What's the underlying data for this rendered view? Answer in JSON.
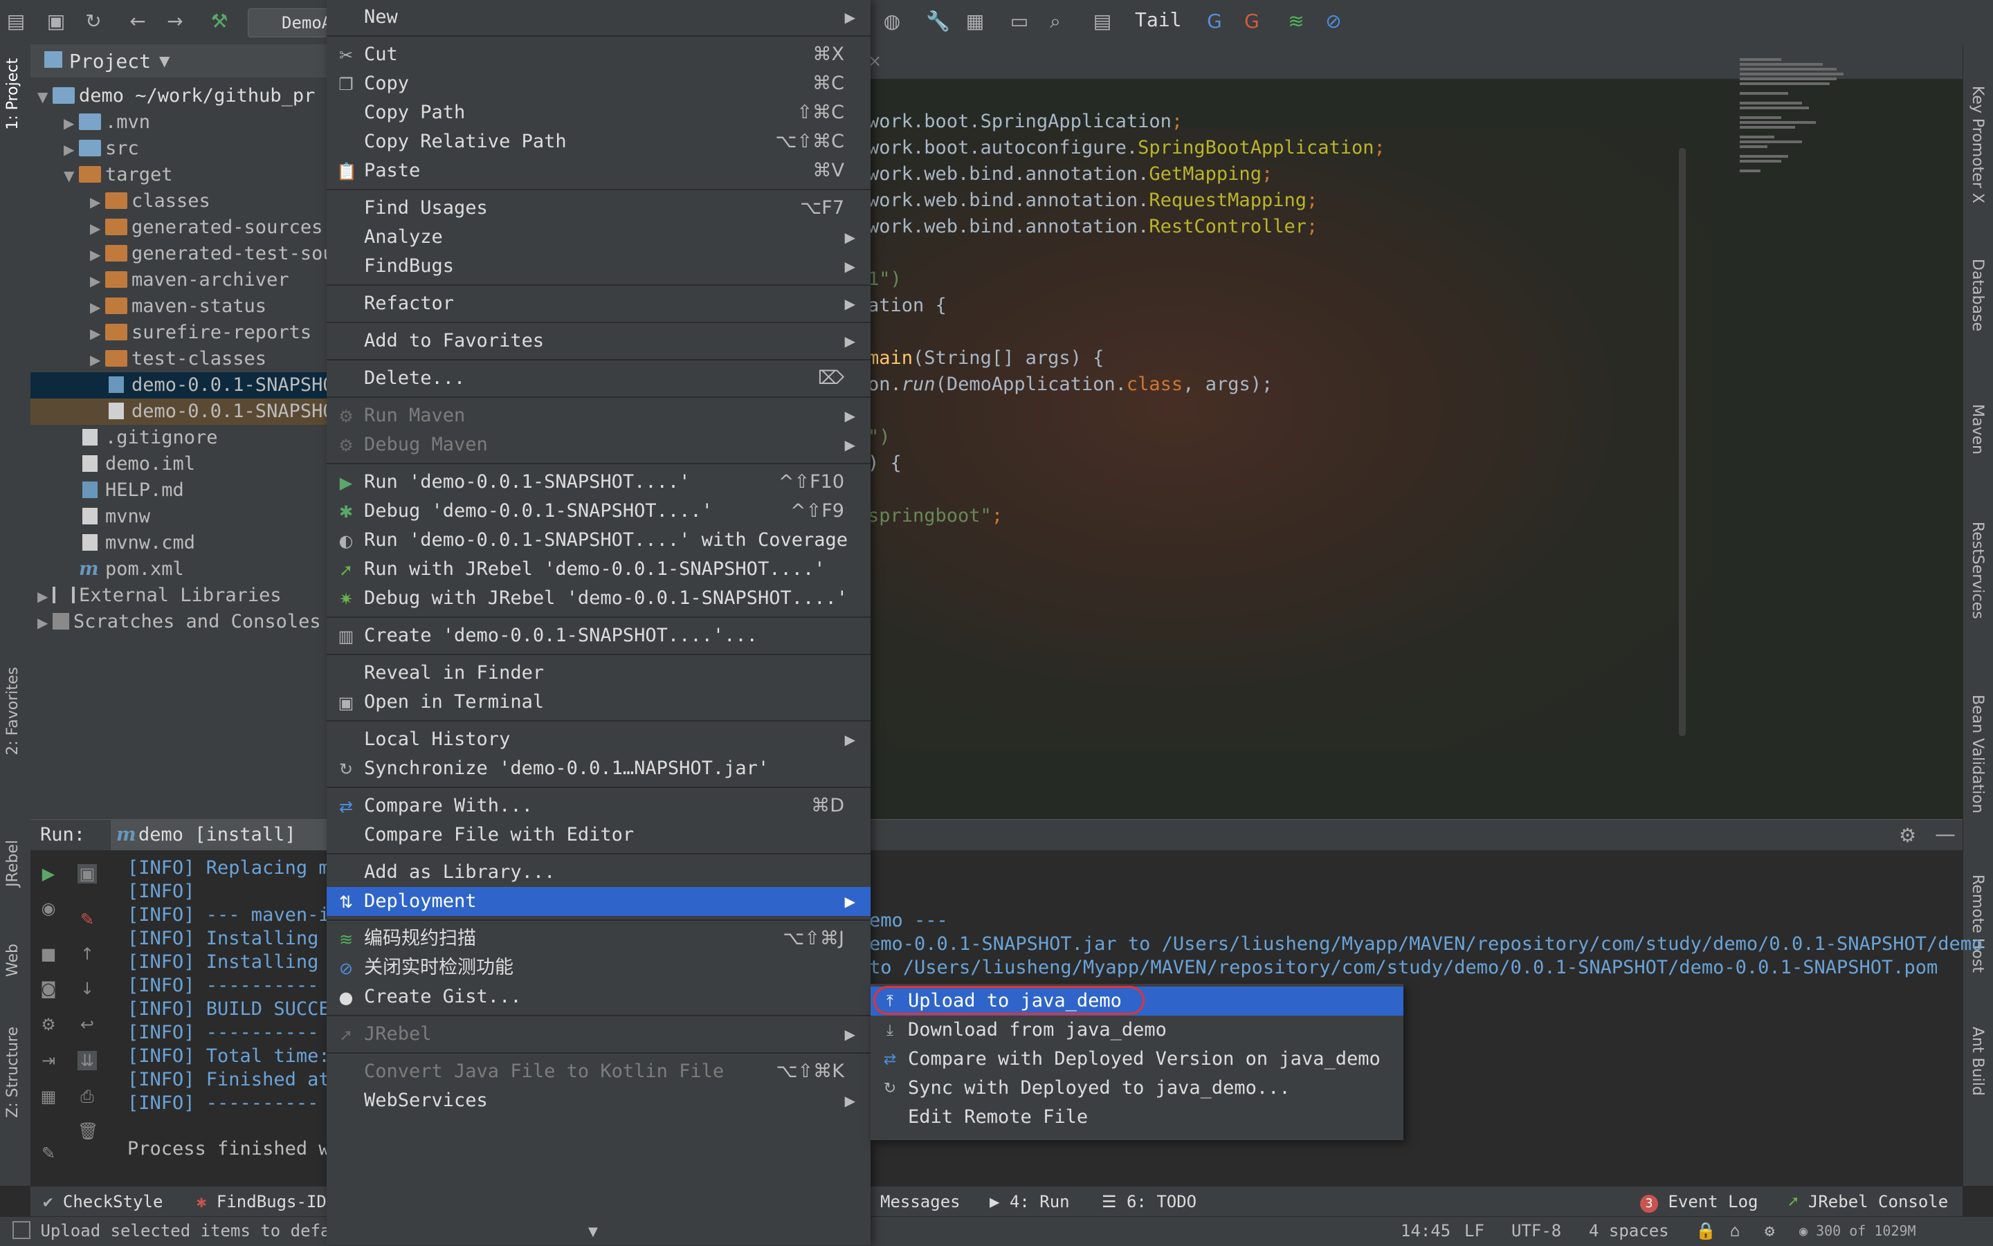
{
  "toolbar": {
    "run_config": "DemoA",
    "tail_label": "Tail",
    "icons": [
      "save-icon",
      "sync-icon",
      "back-icon",
      "forward-icon",
      "build-icon",
      "wrench-icon",
      "project-structure-icon",
      "terminal-icon",
      "search-icon",
      "tasks-icon",
      "translate-icon",
      "translate-alt-icon",
      "scan-icon",
      "no-realtime-icon"
    ]
  },
  "left_strip": {
    "project_tab": "1: Project",
    "favorites_tab": "2: Favorites",
    "jrebel_tab": "JRebel",
    "web_tab": "Web",
    "structure_tab": "Z: Structure"
  },
  "right_strip": {
    "key_promoter": "Key Promoter X",
    "database": "Database",
    "maven": "Maven",
    "rest_services": "RestServices",
    "bean_validation": "Bean Validation",
    "remote_host": "Remote Host",
    "ant_build": "Ant Build"
  },
  "project": {
    "title": "Project",
    "tree": [
      {
        "label": "demo  ~/work/github_pr",
        "level": 0,
        "type": "module"
      },
      {
        "label": ".mvn",
        "level": 1,
        "type": "folder"
      },
      {
        "label": "src",
        "level": 1,
        "type": "folder"
      },
      {
        "label": "target",
        "level": 1,
        "type": "folder-orange"
      },
      {
        "label": "classes",
        "level": 2,
        "type": "folder-orange"
      },
      {
        "label": "generated-sources",
        "level": 2,
        "type": "folder-orange"
      },
      {
        "label": "generated-test-sou",
        "level": 2,
        "type": "folder-orange"
      },
      {
        "label": "maven-archiver",
        "level": 2,
        "type": "folder-orange"
      },
      {
        "label": "maven-status",
        "level": 2,
        "type": "folder-orange"
      },
      {
        "label": "surefire-reports",
        "level": 2,
        "type": "folder-orange"
      },
      {
        "label": "test-classes",
        "level": 2,
        "type": "folder-orange"
      },
      {
        "label": "demo-0.0.1-SNAPSHO",
        "level": 2,
        "type": "jar"
      },
      {
        "label": "demo-0.0.1-SNAPSHO",
        "level": 2,
        "type": "file"
      },
      {
        "label": ".gitignore",
        "level": 1,
        "type": "file"
      },
      {
        "label": "demo.iml",
        "level": 1,
        "type": "file"
      },
      {
        "label": "HELP.md",
        "level": 1,
        "type": "md"
      },
      {
        "label": "mvnw",
        "level": 1,
        "type": "file"
      },
      {
        "label": "mvnw.cmd",
        "level": 1,
        "type": "file"
      },
      {
        "label": "pom.xml",
        "level": 1,
        "type": "maven"
      },
      {
        "label": "External Libraries",
        "level": 0,
        "type": "libs"
      },
      {
        "label": "Scratches and Consoles",
        "level": 0,
        "type": "scratches"
      }
    ]
  },
  "editor": {
    "lines": [
      {
        "segments": [
          {
            "t": "work.boot.",
            "c": "plain"
          },
          {
            "t": "SpringApplication",
            "c": "plain"
          },
          {
            "t": ";",
            "c": "kw"
          }
        ]
      },
      {
        "segments": [
          {
            "t": "work.boot.autoconfigure.",
            "c": "plain"
          },
          {
            "t": "SpringBootApplication",
            "c": "ann"
          },
          {
            "t": ";",
            "c": "kw"
          }
        ]
      },
      {
        "segments": [
          {
            "t": "work.web.bind.annotation.",
            "c": "plain"
          },
          {
            "t": "GetMapping",
            "c": "ann"
          },
          {
            "t": ";",
            "c": "kw"
          }
        ]
      },
      {
        "segments": [
          {
            "t": "work.web.bind.annotation.",
            "c": "plain"
          },
          {
            "t": "RequestMapping",
            "c": "ann"
          },
          {
            "t": ";",
            "c": "kw"
          }
        ]
      },
      {
        "segments": [
          {
            "t": "work.web.bind.annotation.",
            "c": "plain"
          },
          {
            "t": "RestController",
            "c": "ann"
          },
          {
            "t": ";",
            "c": "kw"
          }
        ]
      },
      {
        "segments": [
          {
            "t": "1\")",
            "c": "str"
          }
        ]
      },
      {
        "segments": [
          {
            "t": "ation {",
            "c": "plain"
          }
        ]
      },
      {
        "segments": [
          {
            "t": "main",
            "c": "cls"
          },
          {
            "t": "(String[] args) {",
            "c": "plain"
          }
        ]
      },
      {
        "segments": [
          {
            "t": "on.",
            "c": "plain"
          },
          {
            "t": "run",
            "c": "ital"
          },
          {
            "t": "(DemoApplication.",
            "c": "plain"
          },
          {
            "t": "class",
            "c": "kw"
          },
          {
            "t": ", args);",
            "c": "plain"
          }
        ]
      },
      {
        "segments": [
          {
            "t": "\")",
            "c": "str"
          }
        ]
      },
      {
        "segments": [
          {
            "t": ") {",
            "c": "plain"
          }
        ]
      },
      {
        "segments": [
          {
            "t": "springboot\"",
            "c": "str"
          },
          {
            "t": ";",
            "c": "kw"
          }
        ]
      }
    ]
  },
  "run": {
    "label": "Run:",
    "tab_label": "demo [install]",
    "lines": [
      "[INFO] Replacing m",
      "[INFO]",
      "[INFO] --- maven-i",
      "[INFO] Installing",
      "[INFO] Installing",
      "[INFO] ----------",
      "[INFO] BUILD SUCCE",
      "[INFO] ----------",
      "[INFO] Total time:",
      "[INFO] Finished at",
      "[INFO] ----------"
    ],
    "right_lines": [
      "emo ---",
      "emo-0.0.1-SNAPSHOT.jar to /Users/liusheng/Myapp/MAVEN/repository/com/study/demo/0.0.1-SNAPSHOT/demo",
      "to /Users/liusheng/Myapp/MAVEN/repository/com/study/demo/0.0.1-SNAPSHOT/demo-0.0.1-SNAPSHOT.pom"
    ],
    "process_line": "Process finished w"
  },
  "context_menu": {
    "items": [
      {
        "label": "New",
        "submenu": true,
        "icon": ""
      },
      {
        "sep": true
      },
      {
        "label": "Cut",
        "shortcut": "⌘X",
        "icon": "✂"
      },
      {
        "label": "Copy",
        "shortcut": "⌘C",
        "icon": "❐"
      },
      {
        "label": "Copy Path",
        "shortcut": "⇧⌘C"
      },
      {
        "label": "Copy Relative Path",
        "shortcut": "⌥⇧⌘C"
      },
      {
        "label": "Paste",
        "shortcut": "⌘V",
        "icon": "📋"
      },
      {
        "sep": true
      },
      {
        "label": "Find Usages",
        "shortcut": "⌥F7"
      },
      {
        "label": "Analyze",
        "submenu": true
      },
      {
        "label": "FindBugs",
        "submenu": true
      },
      {
        "sep": true
      },
      {
        "label": "Refactor",
        "submenu": true
      },
      {
        "sep": true
      },
      {
        "label": "Add to Favorites",
        "submenu": true
      },
      {
        "sep": true
      },
      {
        "label": "Delete...",
        "shortcut": "⌦"
      },
      {
        "sep": true
      },
      {
        "label": "Run Maven",
        "submenu": true,
        "disabled": true,
        "icon": "⚙"
      },
      {
        "label": "Debug Maven",
        "submenu": true,
        "disabled": true,
        "icon": "⚙"
      },
      {
        "sep": true
      },
      {
        "label": "Run 'demo-0.0.1-SNAPSHOT....'",
        "shortcut": "^⇧F10",
        "icon": "▶"
      },
      {
        "label": "Debug 'demo-0.0.1-SNAPSHOT....'",
        "shortcut": "^⇧F9",
        "icon": "✱"
      },
      {
        "label": "Run 'demo-0.0.1-SNAPSHOT....' with Coverage",
        "icon": "◐"
      },
      {
        "label": "Run with JRebel 'demo-0.0.1-SNAPSHOT....'",
        "icon": "➚"
      },
      {
        "label": "Debug with JRebel 'demo-0.0.1-SNAPSHOT....'",
        "icon": "✷"
      },
      {
        "sep": true
      },
      {
        "label": "Create 'demo-0.0.1-SNAPSHOT....'...",
        "icon": "▥"
      },
      {
        "sep": true
      },
      {
        "label": "Reveal in Finder"
      },
      {
        "label": "Open in Terminal",
        "icon": "▣"
      },
      {
        "sep": true
      },
      {
        "label": "Local History",
        "submenu": true
      },
      {
        "label": "Synchronize 'demo-0.0.1…NAPSHOT.jar'",
        "icon": "↻"
      },
      {
        "sep": true
      },
      {
        "label": "Compare With...",
        "shortcut": "⌘D",
        "icon": "⇄"
      },
      {
        "label": "Compare File with Editor"
      },
      {
        "sep": true
      },
      {
        "label": "Add as Library..."
      },
      {
        "label": "Deployment",
        "submenu": true,
        "highlighted": true,
        "icon": "⇅"
      },
      {
        "sep": true
      },
      {
        "label": "编码规约扫描",
        "shortcut": "⌥⇧⌘J",
        "icon": "≋"
      },
      {
        "label": "关闭实时检测功能",
        "icon": "⊘"
      },
      {
        "label": "Create Gist...",
        "icon": "●"
      },
      {
        "sep": true
      },
      {
        "label": "JRebel",
        "submenu": true,
        "disabled": true,
        "icon": "➚"
      },
      {
        "sep": true
      },
      {
        "label": "Convert Java File to Kotlin File",
        "shortcut": "⌥⇧⌘K",
        "disabled": true
      },
      {
        "label": "WebServices",
        "submenu": true
      }
    ],
    "scroll_indicator": "▼"
  },
  "deployment_menu": {
    "items": [
      {
        "label": "Upload to java_demo",
        "icon": "⤒",
        "highlighted": true
      },
      {
        "label": "Download from java_demo",
        "icon": "⤓"
      },
      {
        "label": "Compare with Deployed Version on java_demo",
        "icon": "⇄"
      },
      {
        "label": "Sync with Deployed to java_demo...",
        "icon": "↻"
      },
      {
        "label": "Edit Remote File",
        "icon": ""
      }
    ]
  },
  "bottom_tabs": {
    "checkstyle": "CheckStyle",
    "findbugs": "FindBugs-ID",
    "messages": "Messages",
    "run": "4: Run",
    "todo": "6: TODO",
    "event_log": "Event Log",
    "event_count": "3",
    "jrebel_console": "JRebel Console"
  },
  "status": {
    "message": "Upload selected items to defa",
    "position": "14:45",
    "line_sep": "LF",
    "encoding": "UTF-8",
    "indent": "4 spaces",
    "memory": "300 of 1029M"
  },
  "colors": {
    "accent": "#2f65ca",
    "highlight_circle": "#e53232",
    "panel": "#3c3f41",
    "console_blue": "#6aa3d8"
  }
}
